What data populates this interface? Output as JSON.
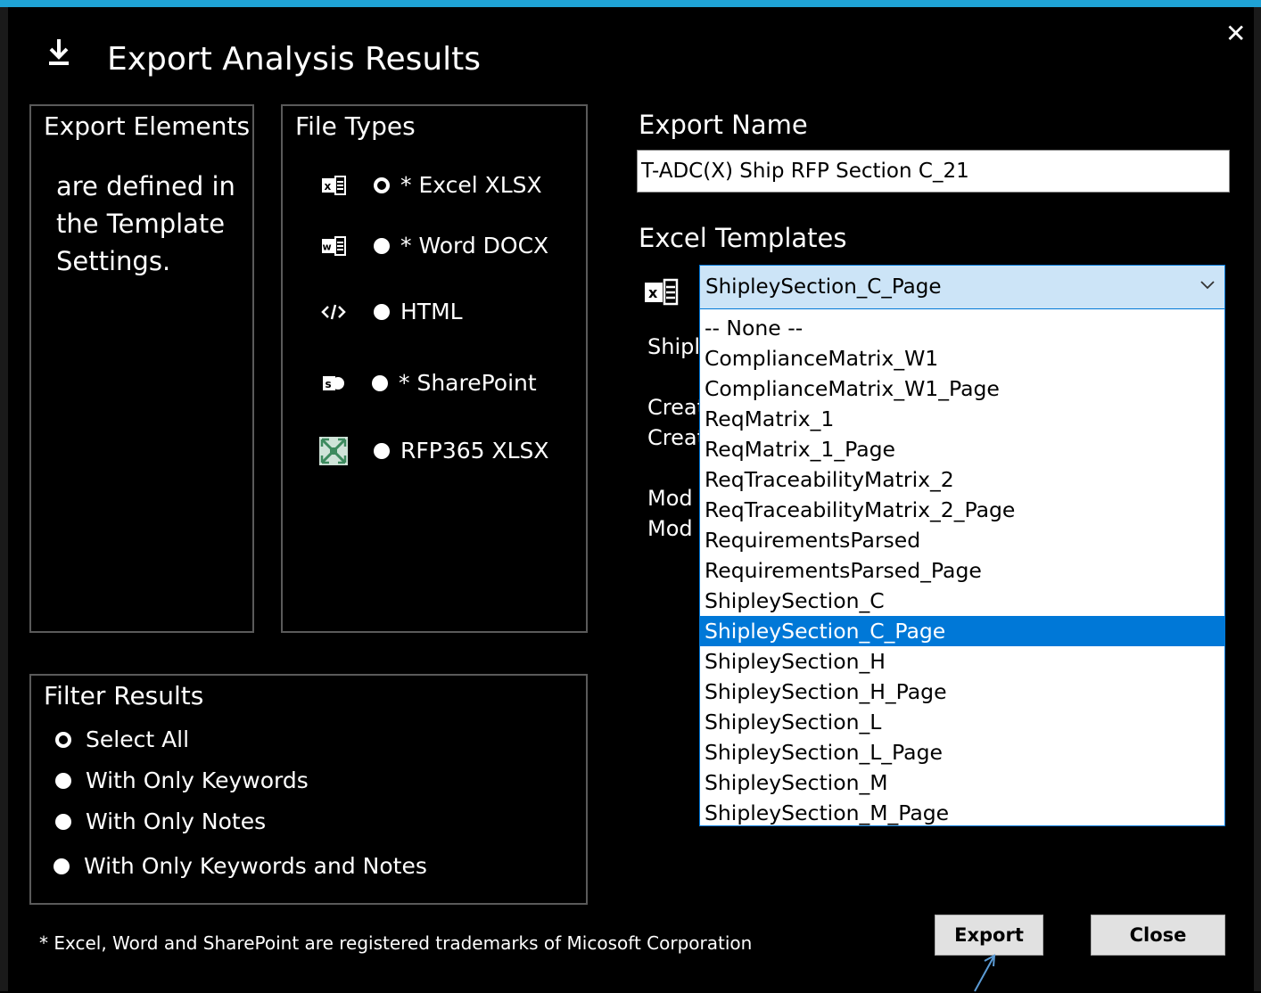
{
  "window": {
    "title": "Export Analysis Results",
    "accent_color": "#1fa3d6",
    "close_glyph": "✕"
  },
  "export_elements": {
    "heading": "Export Elements",
    "note": "are defined in the Template Settings."
  },
  "file_types": {
    "heading": "File Types",
    "items": [
      {
        "label": "* Excel XLSX",
        "icon": "excel-icon",
        "selected": true
      },
      {
        "label": "* Word DOCX",
        "icon": "word-icon",
        "selected": false
      },
      {
        "label": "HTML",
        "icon": "code-icon",
        "selected": false
      },
      {
        "label": "* SharePoint",
        "icon": "sharepoint-icon",
        "selected": false
      },
      {
        "label": "RFP365 XLSX",
        "icon": "rfp365-icon",
        "selected": false
      }
    ]
  },
  "filter_results": {
    "heading": "Filter Results",
    "items": [
      {
        "label": "Select All",
        "selected": true
      },
      {
        "label": "With Only Keywords",
        "selected": false
      },
      {
        "label": "With Only Notes",
        "selected": false
      },
      {
        "label": "With Only Keywords and Notes",
        "selected": false
      }
    ]
  },
  "export_name": {
    "label": "Export Name",
    "value": "T-ADC(X) Ship RFP Section C_21"
  },
  "excel_templates": {
    "label": "Excel Templates",
    "selected": "ShipleySection_C_Page",
    "options": [
      "-- None --",
      "ComplianceMatrix_W1",
      "ComplianceMatrix_W1_Page",
      "ReqMatrix_1",
      "ReqMatrix_1_Page",
      "ReqTraceabilityMatrix_2",
      "ReqTraceabilityMatrix_2_Page",
      "RequirementsParsed",
      "RequirementsParsed_Page",
      "ShipleySection_C",
      "ShipleySection_C_Page",
      "ShipleySection_H",
      "ShipleySection_H_Page",
      "ShipleySection_L",
      "ShipleySection_L_Page",
      "ShipleySection_M",
      "ShipleySection_M_Page"
    ],
    "highlight_color": "#0078d7"
  },
  "template_info": {
    "line1": "Shipl",
    "line2": "Creat",
    "line3": "Creat",
    "line4": "Mod",
    "line5": "Mod"
  },
  "footer": {
    "trademark": "* Excel, Word and SharePoint are registered trademarks of Micosoft Corporation"
  },
  "buttons": {
    "export": "Export",
    "close": "Close"
  }
}
